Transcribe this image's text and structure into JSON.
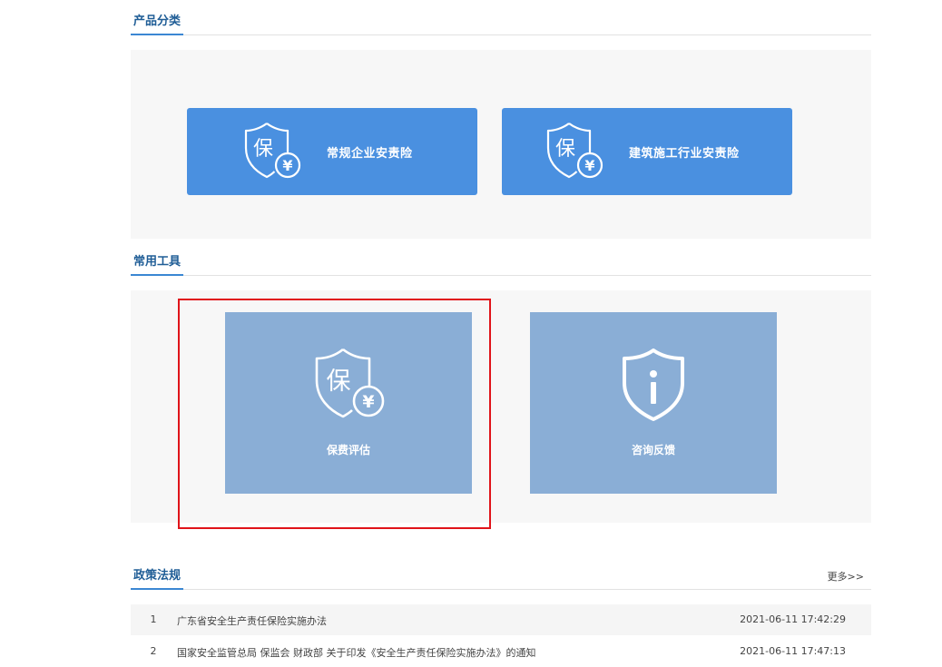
{
  "sections": {
    "products_title": "产品分类",
    "tools_title": "常用工具",
    "policy_title": "政策法规",
    "policy_more": "更多>>"
  },
  "products": [
    {
      "label": "常规企业安责险",
      "icon": "insurance-shield-yen-icon"
    },
    {
      "label": "建筑施工行业安责险",
      "icon": "insurance-shield-yen-icon"
    }
  ],
  "tools": [
    {
      "label": "保费评估",
      "icon": "insurance-shield-yen-icon",
      "highlighted": true
    },
    {
      "label": "咨询反馈",
      "icon": "info-shield-icon",
      "highlighted": false
    }
  ],
  "icon_glyphs": {
    "bao": "保",
    "yen": "¥"
  },
  "policies": [
    {
      "num": "1",
      "title": "广东省安全生产责任保险实施办法",
      "date": "2021-06-11 17:42:29"
    },
    {
      "num": "2",
      "title": "国家安全监管总局 保监会 财政部 关于印发《安全生产责任保险实施办法》的通知",
      "date": "2021-06-11 17:47:13"
    }
  ],
  "colors": {
    "product_button": "#4a90e0",
    "tool_card": "#8aaed6",
    "title_blue": "#1f5d96",
    "highlight_red": "#e0141a",
    "panel_bg": "#f7f7f7"
  }
}
